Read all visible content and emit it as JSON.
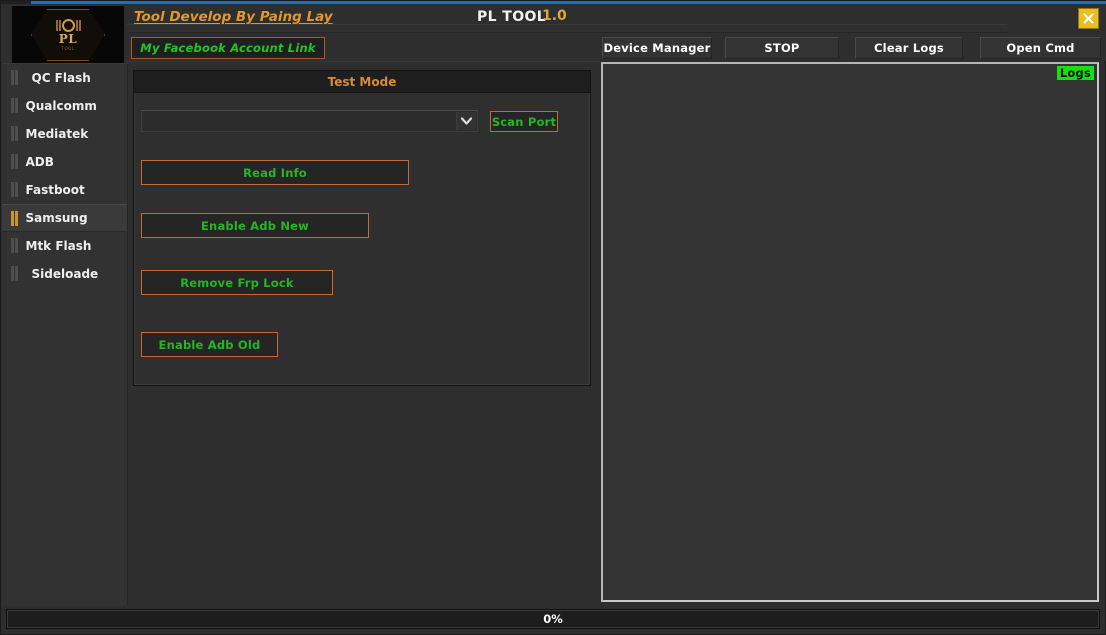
{
  "window": {
    "accent_blue": "#1273c8",
    "accent_orange": "#c36a36",
    "accent_green": "#25b625",
    "accent_gold": "#e0a731",
    "background": "#2e2e2e",
    "close_label": "X"
  },
  "header": {
    "developer_link": "Tool Develop By Paing Lay",
    "app_title": "PL TOOL",
    "version": "1.0",
    "facebook_link": "My Facebook Account Link",
    "logo_text": "PL",
    "logo_subtext": "TOOL"
  },
  "toolbar": {
    "buttons": [
      {
        "label": "Device Manager"
      },
      {
        "label": "STOP"
      },
      {
        "label": "Clear Logs"
      },
      {
        "label": "Open Cmd"
      }
    ]
  },
  "sidebar": {
    "items": [
      {
        "label": "QC Flash",
        "active": false,
        "indent": true
      },
      {
        "label": "Qualcomm",
        "active": false,
        "indent": false
      },
      {
        "label": "Mediatek",
        "active": false,
        "indent": false
      },
      {
        "label": "ADB",
        "active": false,
        "indent": false
      },
      {
        "label": "Fastboot",
        "active": false,
        "indent": false
      },
      {
        "label": "Samsung",
        "active": true,
        "indent": false
      },
      {
        "label": "Mtk Flash",
        "active": false,
        "indent": false
      },
      {
        "label": "Sideloade",
        "active": false,
        "indent": true
      }
    ]
  },
  "panel": {
    "title": "Test Mode",
    "port_select": {
      "value": "",
      "placeholder": ""
    },
    "scan_port_label": "Scan Port",
    "actions": [
      {
        "label": "Read Info"
      },
      {
        "label": "Enable Adb New"
      },
      {
        "label": "Remove Frp Lock"
      },
      {
        "label": "Enable Adb Old"
      }
    ]
  },
  "logs": {
    "badge": "Logs",
    "content": ""
  },
  "status": {
    "progress_label": "0%",
    "progress_percent": 0
  }
}
